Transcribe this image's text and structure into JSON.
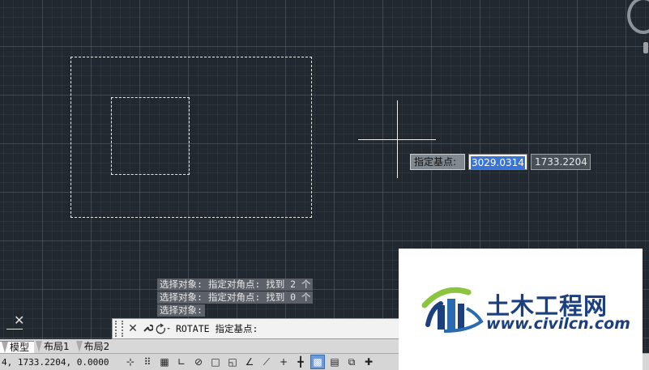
{
  "canvas": {
    "background": "#212830",
    "grid_color": "#5a6473"
  },
  "dynamic_input": {
    "prompt": "指定基点:",
    "x_value": "3029.0314",
    "y_value": "1733.2204"
  },
  "history": [
    "选择对象: 指定对角点: 找到 2 个",
    "选择对象: 指定对角点: 找到 0 个",
    "选择对象:"
  ],
  "command_line": {
    "text": "ROTATE 指定基点:",
    "close_icon": "close-icon",
    "customize_icon": "wrench-icon",
    "command_icon": "rotate-icon"
  },
  "tabs": [
    {
      "label": "模型",
      "active": true
    },
    {
      "label": "布局1",
      "active": false
    },
    {
      "label": "布局2",
      "active": false
    }
  ],
  "statusbar": {
    "coordinates": "4, 1733.2204, 0.0000",
    "buttons": [
      {
        "icon": "infer-constraints-icon",
        "on": false
      },
      {
        "icon": "snap-mode-icon",
        "on": false
      },
      {
        "icon": "grid-display-icon",
        "on": false
      },
      {
        "icon": "ortho-mode-icon",
        "on": false
      },
      {
        "icon": "polar-tracking-icon",
        "on": false
      },
      {
        "icon": "object-snap-icon",
        "on": false
      },
      {
        "icon": "3d-object-snap-icon",
        "on": false
      },
      {
        "icon": "object-snap-tracking-icon",
        "on": false
      },
      {
        "icon": "dynamic-ucs-icon",
        "on": false
      },
      {
        "icon": "dynamic-input-icon",
        "on": false
      },
      {
        "icon": "lineweight-icon",
        "on": false
      },
      {
        "icon": "transparency-icon",
        "on": true
      },
      {
        "icon": "quick-properties-icon",
        "on": false
      },
      {
        "icon": "selection-cycling-icon",
        "on": false
      },
      {
        "icon": "annotation-monitor-icon",
        "on": false
      }
    ]
  },
  "watermark": {
    "title": "土木工程网",
    "url": "www.civilcn.com",
    "colors": {
      "blue": "#1c3f7e",
      "green": "#8bc53f"
    }
  }
}
